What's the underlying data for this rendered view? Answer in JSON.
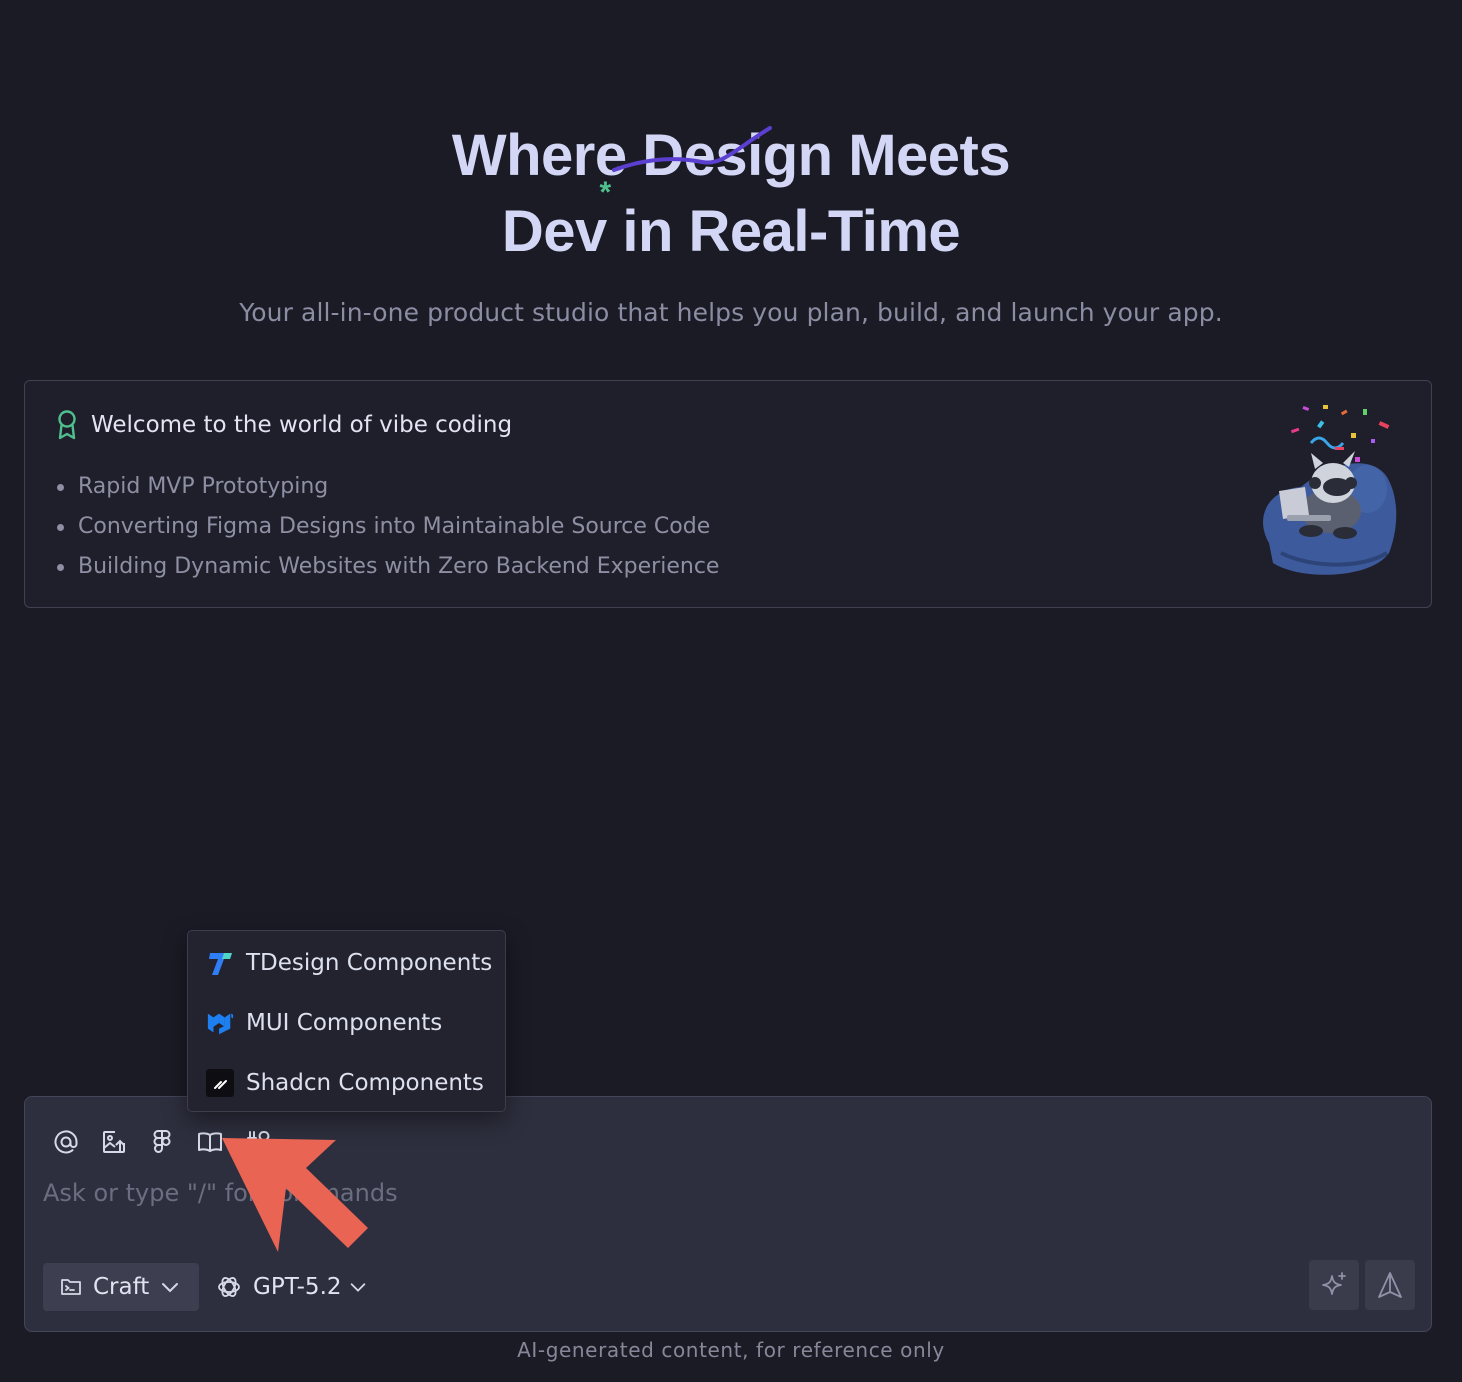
{
  "hero": {
    "title_line1_before": "Where ",
    "title_line1_word": "Design",
    "title_line1_after": " Meets",
    "title_line2_word": "Dev",
    "title_line2_after": " in Real-Time",
    "asterisk": "*",
    "subtitle": "Your all-in-one product studio that helps you plan, build, and launch your app."
  },
  "welcome": {
    "title": "Welcome to the world of vibe coding",
    "features": [
      "Rapid MVP Prototyping",
      "Converting Figma Designs into Maintainable Source Code",
      "Building Dynamic Websites with Zero Backend Experience"
    ]
  },
  "kb_menu": {
    "items": [
      {
        "label": "TDesign Components",
        "icon": "tdesign-logo-icon"
      },
      {
        "label": "MUI Components",
        "icon": "mui-logo-icon"
      },
      {
        "label": "Shadcn Components",
        "icon": "shadcn-logo-icon"
      }
    ]
  },
  "composer": {
    "tools": [
      "at-mention-icon",
      "image-upload-icon",
      "figma-icon",
      "book-icon",
      "tools-icon"
    ],
    "placeholder": "Ask or type \"/\" for commands",
    "value": "",
    "mode_label": "Craft",
    "model_label": "GPT-5.2"
  },
  "footer": {
    "disclaimer": "AI-generated content, for reference only"
  },
  "colors": {
    "background": "#1b1b26",
    "title": "#d3d7f5",
    "accent_green": "#4fc08d",
    "strike_purple": "#5b3fd0",
    "pointer_arrow": "#ea6453"
  }
}
